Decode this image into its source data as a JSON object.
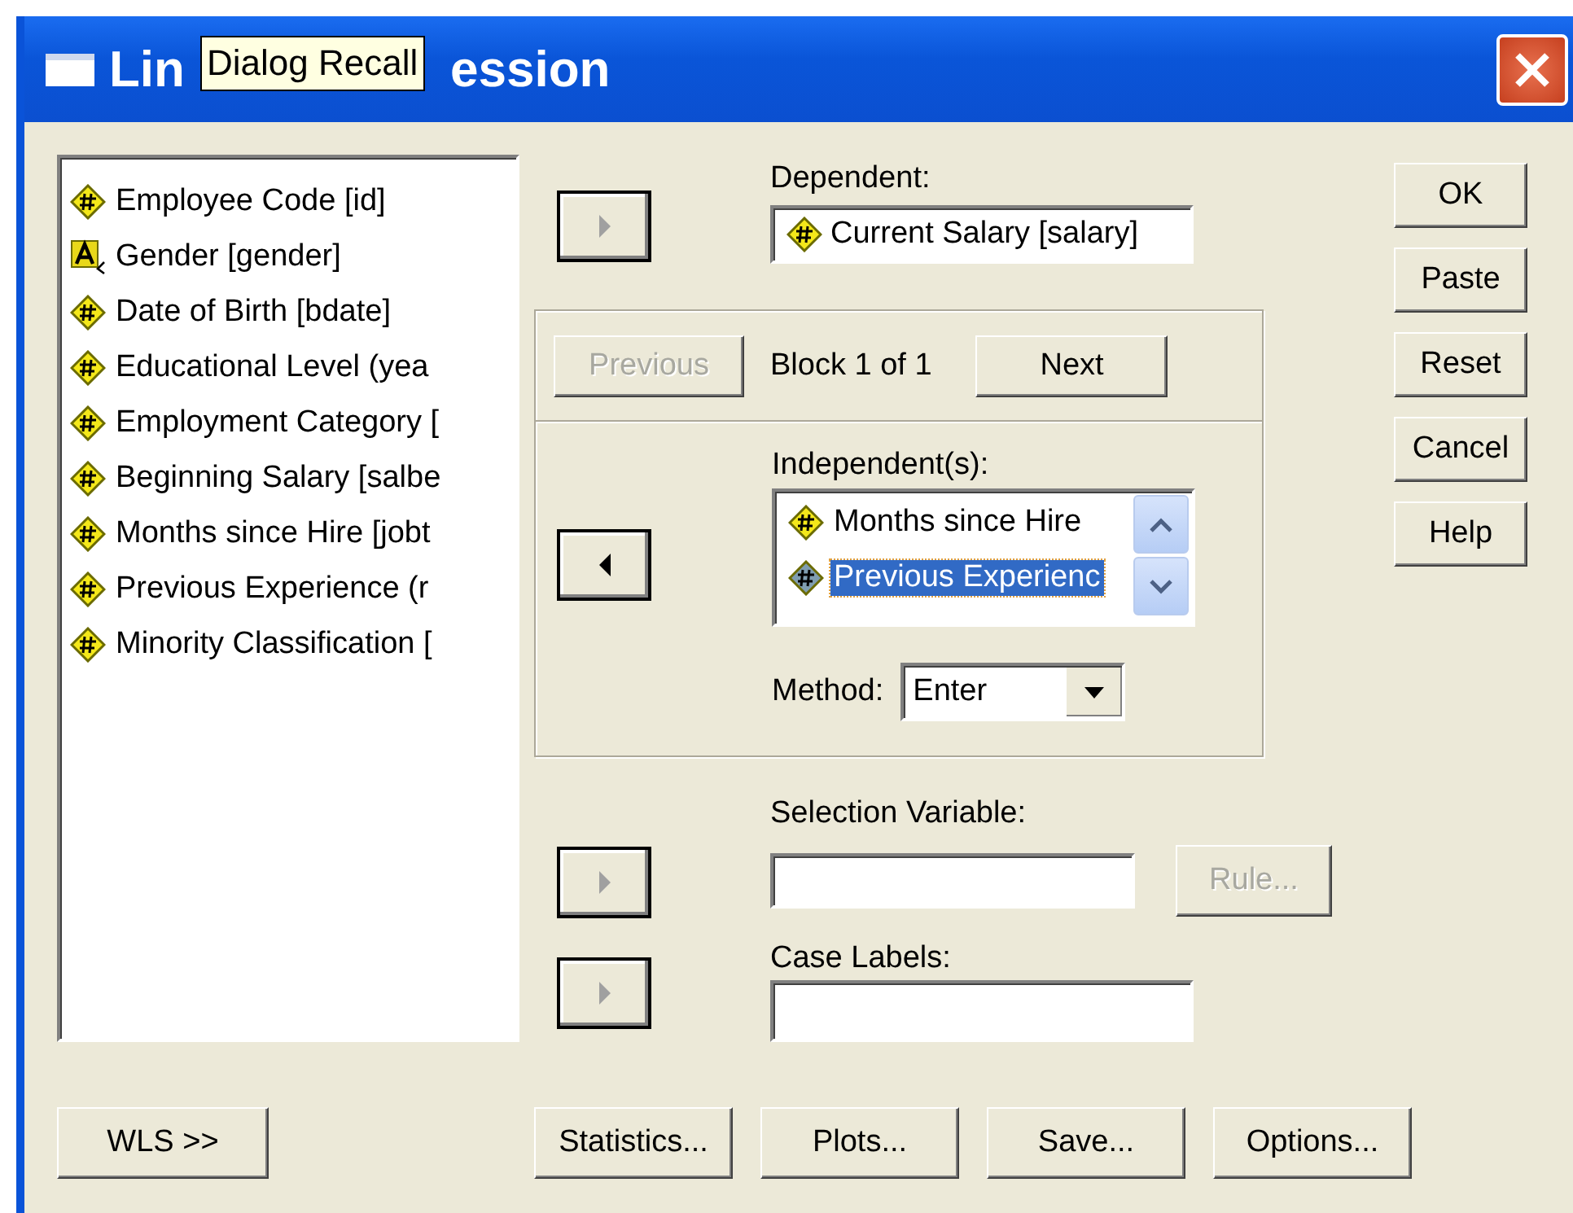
{
  "window": {
    "title_start": "Lin",
    "title_end": "ession",
    "tooltip": "Dialog Recall"
  },
  "variables": [
    {
      "name": "Employee Code [id]",
      "kind": "numeric",
      "selected": false
    },
    {
      "name": "Gender [gender]",
      "kind": "string",
      "selected": false
    },
    {
      "name": "Date of Birth [bdate]",
      "kind": "numeric",
      "selected": false
    },
    {
      "name": "Educational Level (yea",
      "kind": "numeric",
      "selected": false
    },
    {
      "name": "Employment Category [",
      "kind": "numeric",
      "selected": false
    },
    {
      "name": "Beginning Salary [salbe",
      "kind": "numeric",
      "selected": false
    },
    {
      "name": "Months since Hire [jobt",
      "kind": "numeric",
      "selected": false
    },
    {
      "name": "Previous Experience (r",
      "kind": "numeric",
      "selected": false
    },
    {
      "name": "Minority Classification [",
      "kind": "numeric",
      "selected": false
    }
  ],
  "dependent": {
    "label": "Dependent:",
    "arrow": {
      "kind": "right",
      "disabled": true
    },
    "value": {
      "name": "Current Salary [salary]",
      "kind": "numeric"
    }
  },
  "block": {
    "previous": {
      "label": "Previous",
      "disabled": true
    },
    "text": "Block 1 of 1",
    "next": {
      "label": "Next",
      "disabled": false
    },
    "arrow": {
      "kind": "left",
      "disabled": false
    },
    "label": "Independent(s):",
    "items": [
      {
        "name": "Months since Hire",
        "kind": "numeric",
        "selected": false
      },
      {
        "name": "Previous Experienc",
        "kind": "numeric",
        "selected": true
      }
    ],
    "method_label": "Method:",
    "method": "Enter"
  },
  "selection": {
    "label": "Selection Variable:",
    "arrow": {
      "kind": "right",
      "disabled": true
    },
    "rule": {
      "label": "Rule...",
      "disabled": true
    }
  },
  "case_labels": {
    "label": "Case Labels:",
    "arrow": {
      "kind": "right",
      "disabled": true
    }
  },
  "side_buttons": [
    "OK",
    "Paste",
    "Reset",
    "Cancel",
    "Help"
  ],
  "wls_button": "WLS >>",
  "bottom_buttons": [
    "Statistics...",
    "Plots...",
    "Save...",
    "Options..."
  ]
}
